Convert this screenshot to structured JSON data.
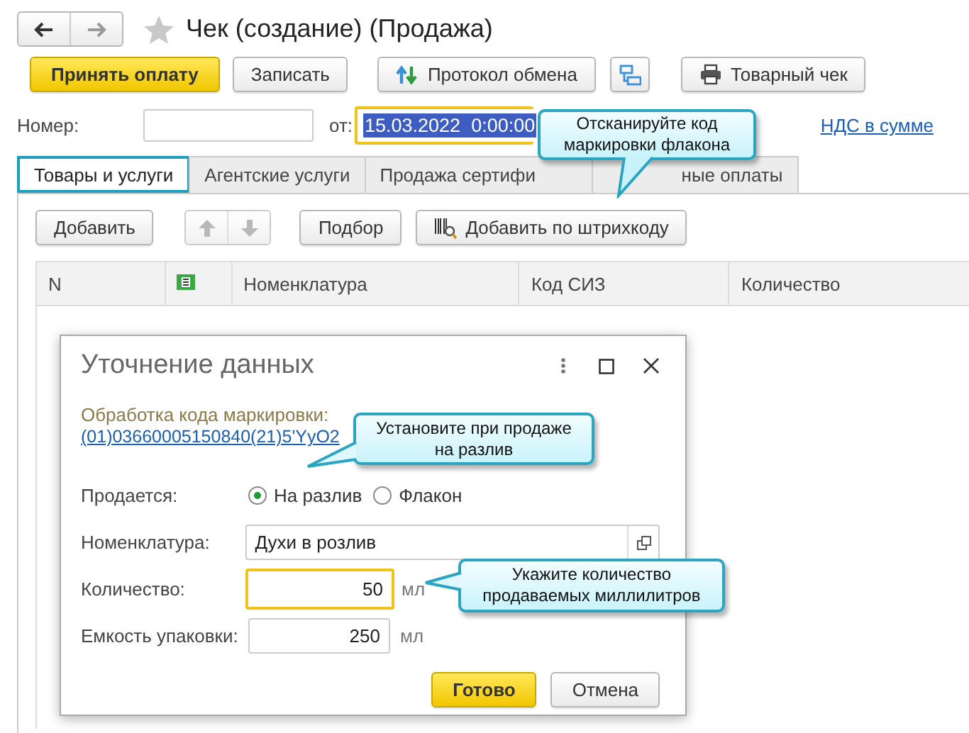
{
  "window": {
    "title": "Чек (создание) (Продажа)",
    "favorite": false
  },
  "toolbar": [
    {
      "label": "Принять оплату",
      "kind": "primary"
    },
    {
      "label": "Записать",
      "kind": "plain"
    },
    {
      "label": "Протокол обмена",
      "kind": "exchange"
    },
    {
      "kind": "structure"
    },
    {
      "label": "Товарный чек",
      "kind": "print"
    }
  ],
  "number": {
    "label": "Номер:"
  },
  "date": {
    "label": "от:",
    "value": "15.03.2022  0:00:00",
    "highlighted": true
  },
  "vat_link": "НДС в сумме",
  "tabs": [
    {
      "label": "Товары и услуги",
      "selected": true
    },
    {
      "label": "Агентские услуги",
      "selected": false
    },
    {
      "label": "Продажа сертифи",
      "selected": false
    },
    {
      "label": "ные оплаты",
      "selected": false
    }
  ],
  "table_toolbar": [
    {
      "label": "Добавить",
      "kind": "plain"
    },
    {
      "kind": "up"
    },
    {
      "kind": "down"
    },
    {
      "label": "Подбор",
      "kind": "plain"
    },
    {
      "label": "Добавить по штрихкоду",
      "kind": "barcode"
    }
  ],
  "table": {
    "columns": [
      {
        "label": "N",
        "kind": "text"
      },
      {
        "kind": "icon"
      },
      {
        "label": "Номенклатура",
        "kind": "text"
      },
      {
        "label": "Код СИЗ",
        "kind": "text"
      },
      {
        "label": "Количество",
        "kind": "text"
      }
    ]
  },
  "dialog": {
    "title": "Уточнение данных",
    "code_label": "Обработка кода маркировки:",
    "code_link": "(01)03660005150840(21)5'YyO2",
    "sold_as": {
      "label": "Продается:",
      "options": [
        {
          "label": "На разлив",
          "selected": true
        },
        {
          "label": "Флакон",
          "selected": false
        }
      ]
    },
    "fields": [
      {
        "label": "Номенклатура:",
        "value": "Духи в розлив",
        "kind": "choice",
        "focused": false
      },
      {
        "label": "Количество:",
        "value": "50",
        "unit": "мл",
        "kind": "number",
        "focused": true
      },
      {
        "label": "Емкость упаковки:",
        "value": "250",
        "unit": "мл",
        "kind": "number",
        "focused": false
      }
    ],
    "buttons": [
      {
        "label": "Готово",
        "kind": "primary"
      },
      {
        "label": "Отмена",
        "kind": "plain"
      }
    ]
  },
  "callouts": [
    {
      "text": "Отсканируйте код маркировки флакона"
    },
    {
      "text": "Установите при продаже на разлив"
    },
    {
      "text": "Укажите количество продаваемых миллилитров"
    }
  ]
}
